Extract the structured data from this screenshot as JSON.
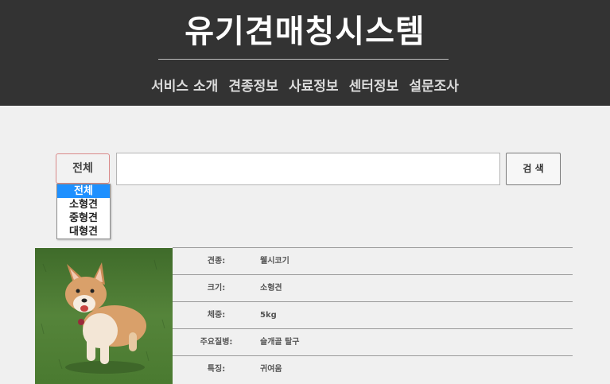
{
  "header": {
    "title": "유기견매칭시스템",
    "nav": [
      "서비스 소개",
      "견종정보",
      "사료정보",
      "센터정보",
      "설문조사"
    ]
  },
  "search": {
    "category_selected": "전체",
    "options": [
      "전체",
      "소형견",
      "중형견",
      "대형견"
    ],
    "input_value": "",
    "button_label": "검 색"
  },
  "result": {
    "rows": [
      {
        "key": "견종:",
        "value": "웰시코기"
      },
      {
        "key": "크기:",
        "value": "소형견"
      },
      {
        "key": "체중:",
        "value": "5kg"
      },
      {
        "key": "주요질병:",
        "value": "슬개골 탈구"
      },
      {
        "key": "특징:",
        "value": "귀여움"
      }
    ]
  },
  "colors": {
    "header_bg": "#333333",
    "page_bg": "#f0f0f0",
    "option_highlight": "#1e90ff",
    "select_border": "#d98a8a"
  }
}
